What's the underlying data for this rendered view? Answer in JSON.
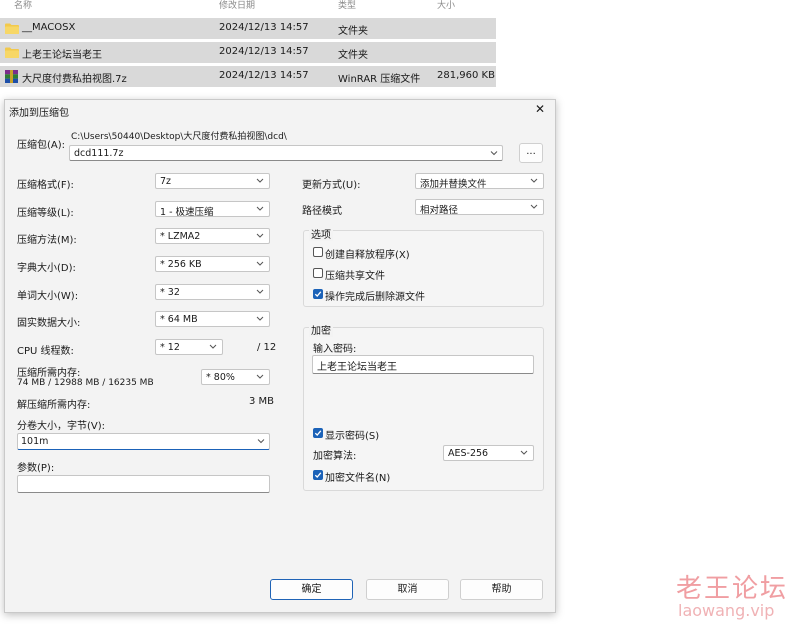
{
  "file_list": {
    "headers": {
      "name": "名称",
      "modified": "修改日期",
      "type": "类型",
      "size": "大小"
    },
    "rows": [
      {
        "name": "__MACOSX",
        "modified": "2024/12/13 14:57",
        "type": "文件夹",
        "size": "",
        "icon": "folder-icon"
      },
      {
        "name": "上老王论坛当老王",
        "modified": "2024/12/13 14:57",
        "type": "文件夹",
        "size": "",
        "icon": "folder-icon"
      },
      {
        "name": "大尺度付费私拍视图.7z",
        "modified": "2024/12/13 14:57",
        "type": "WinRAR 压缩文件",
        "size": "281,960 KB",
        "icon": "winrar-archive-icon"
      }
    ]
  },
  "dialog": {
    "title": "添加到压缩包",
    "close": "✕",
    "archive": {
      "label": "压缩包(A):",
      "path": "C:\\Users\\50440\\Desktop\\大尺度付费私拍视图\\dcd\\",
      "value": "dcd111.7z",
      "browse": "..."
    },
    "left": {
      "format_label": "压缩格式(F):",
      "format_value": "7z",
      "level_label": "压缩等级(L):",
      "level_value": "1 - 极速压缩",
      "method_label": "压缩方法(M):",
      "method_value": "* LZMA2",
      "dict_label": "字典大小(D):",
      "dict_value": "* 256 KB",
      "word_label": "单词大小(W):",
      "word_value": "* 32",
      "solid_label": "固实数据大小:",
      "solid_value": "* 64 MB",
      "cpu_label": "CPU 线程数:",
      "cpu_value": "* 12",
      "cpu_total": "/ 12",
      "mem_label": "压缩所需内存:",
      "mem_detail": "74 MB / 12988 MB / 16235 MB",
      "mem_value": "* 80%",
      "decomp_label": "解压缩所需内存:",
      "decomp_value": "3 MB",
      "split_label": "分卷大小，字节(V):",
      "split_value": "101m",
      "params_label": "参数(P):",
      "params_value": ""
    },
    "right": {
      "update_label": "更新方式(U):",
      "update_value": "添加并替换文件",
      "path_label": "路径模式",
      "path_value": "相对路径",
      "options_title": "选项",
      "opt_sfx": "创建自释放程序(X)",
      "opt_sfx_checked": false,
      "opt_shared": "压缩共享文件",
      "opt_shared_checked": false,
      "opt_delete": "操作完成后删除源文件",
      "opt_delete_checked": true,
      "encrypt_title": "加密",
      "password_label": "输入密码:",
      "password_value": "上老王论坛当老王",
      "show_pw": "显示密码(S)",
      "show_pw_checked": true,
      "algo_label": "加密算法:",
      "algo_value": "AES-256",
      "enc_names": "加密文件名(N)",
      "enc_names_checked": true
    },
    "buttons": {
      "ok": "确定",
      "cancel": "取消",
      "help": "帮助"
    }
  },
  "watermark": {
    "title": "老王论坛",
    "url": "laowang.vip"
  },
  "colors": {
    "accent": "#1b62b8",
    "selection": "#d9d9d9",
    "watermark": "#f09ea2"
  }
}
